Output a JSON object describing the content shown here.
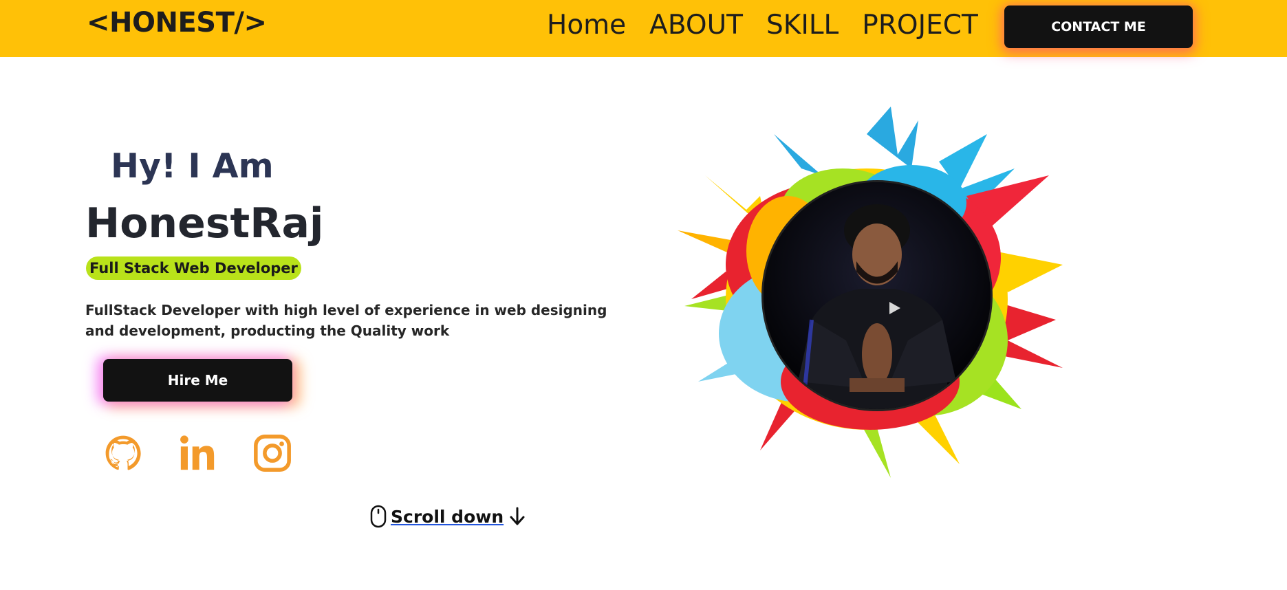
{
  "nav": {
    "logo": "<HONEST/>",
    "links": [
      "Home",
      "ABOUT",
      "SKILL",
      "PROJECT"
    ],
    "contact_label": "CONTACT ME"
  },
  "hero": {
    "greeting": "Hy! I Am",
    "name": "HonestRaj",
    "role": "Full Stack Web Developer",
    "description": "FullStack Developer with high level of experience in web designing and development, producting the Quality work",
    "hire_label": "Hire Me",
    "scroll_label": "Scroll down"
  },
  "social": {
    "icons": [
      "github-icon",
      "linkedin-icon",
      "instagram-icon"
    ],
    "color": "#f39a2b"
  },
  "colors": {
    "navbar": "#ffc107",
    "button_dark": "#121212",
    "badge": "#b9e21a",
    "greeting": "#2c3554"
  }
}
